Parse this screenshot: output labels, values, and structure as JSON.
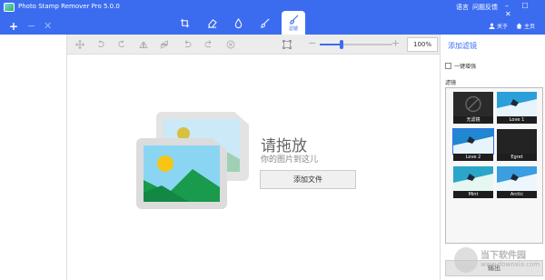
{
  "app": {
    "title": "Photo Stamp Remover Pro 5.0.0",
    "accent": "#3b6cf0"
  },
  "titlebar": {
    "add_label": "+",
    "minus_label": "−",
    "close_label": "✕",
    "active_tool_label": "滤镜",
    "tools": [
      "crop-icon",
      "eraser-icon",
      "drop-icon",
      "brush-icon",
      "filter-icon"
    ],
    "language": "语言",
    "feedback": "问题反馈",
    "window_buttons": "– ☐ ✕",
    "about": "关于",
    "home": "主页"
  },
  "toolbar": {
    "icons": [
      "move-icon",
      "rotate-left-icon",
      "rotate-right-icon",
      "flip-vertical-icon",
      "flip-horizontal-icon",
      "undo-icon",
      "redo-icon",
      "cancel-icon",
      "fit-screen-icon"
    ],
    "zoom_minus": "−",
    "zoom_plus": "+",
    "zoom_value": "100%",
    "zoom_level": 0.3
  },
  "canvas": {
    "title": "请拖放",
    "subtitle": "你的图片到这儿",
    "add_file": "添加文件"
  },
  "right_panel": {
    "title": "添加滤镜",
    "one_click": "一键增强",
    "filter_label": "滤镜",
    "filters": [
      {
        "name": "无滤镜",
        "type": "none"
      },
      {
        "name": "Love 1",
        "type": "photo"
      },
      {
        "name": "Love 2",
        "type": "photo"
      },
      {
        "name": "Egret",
        "type": "dark"
      },
      {
        "name": "Mint",
        "type": "photo"
      },
      {
        "name": "Arctic",
        "type": "photo"
      }
    ],
    "export": "输出"
  },
  "watermark": {
    "text": "当下软件园",
    "url": "www.downxia.com"
  }
}
